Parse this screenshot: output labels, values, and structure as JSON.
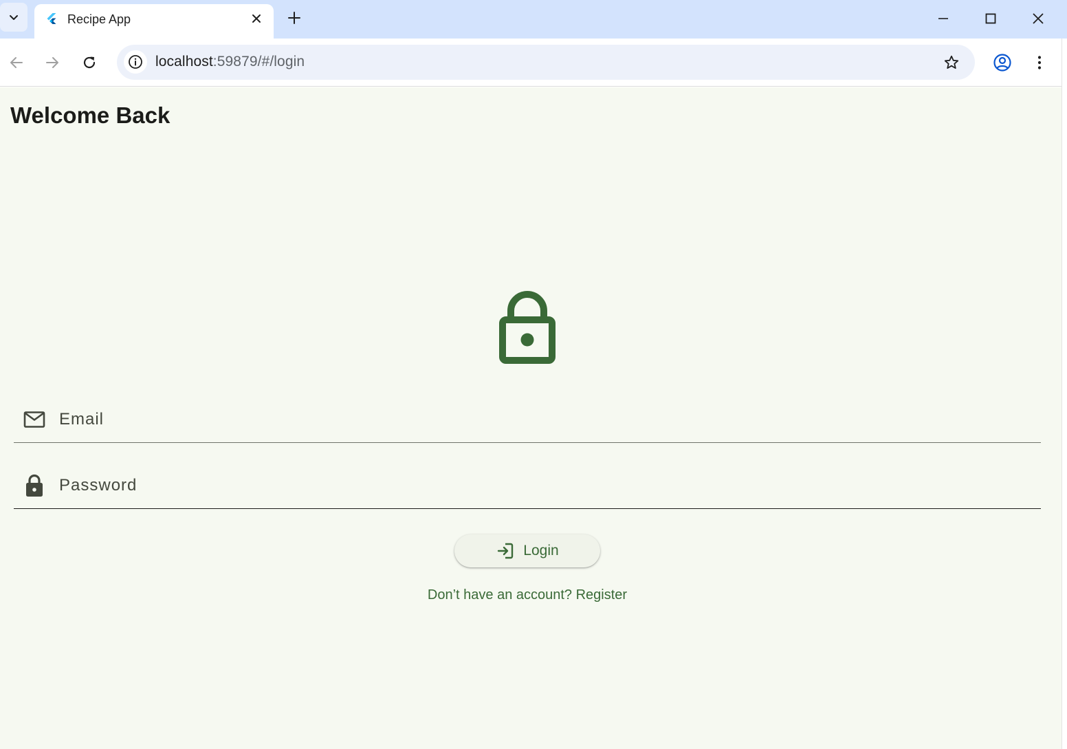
{
  "browser": {
    "tab": {
      "title": "Recipe App",
      "favicon": "flutter-icon"
    },
    "address": {
      "host": "localhost",
      "rest": ":59879/#/login"
    },
    "icons": {
      "tab_search": "chevron-down-icon",
      "close_tab": "close-icon",
      "new_tab": "plus-icon",
      "minimize": "minimize-icon",
      "maximize": "maximize-icon",
      "close_window": "close-icon",
      "back": "arrow-left-icon",
      "forward": "arrow-right-icon",
      "reload": "reload-icon",
      "site_info": "info-icon",
      "bookmark": "star-icon",
      "profile": "account-icon",
      "menu": "kebab-menu-icon"
    }
  },
  "page": {
    "title": "Welcome Back",
    "hero_icon": "lock-icon",
    "email": {
      "placeholder": "Email",
      "value": "",
      "icon": "mail-icon"
    },
    "password": {
      "placeholder": "Password",
      "value": "",
      "icon": "lock-icon"
    },
    "login_button": {
      "label": "Login",
      "icon": "login-icon"
    },
    "register_link": "Don’t have an account? Register"
  },
  "colors": {
    "primary": "#3a6a37",
    "background": "#f6f9f1",
    "tabstrip": "#d3e3fd",
    "omnibox": "#edf1fa"
  }
}
